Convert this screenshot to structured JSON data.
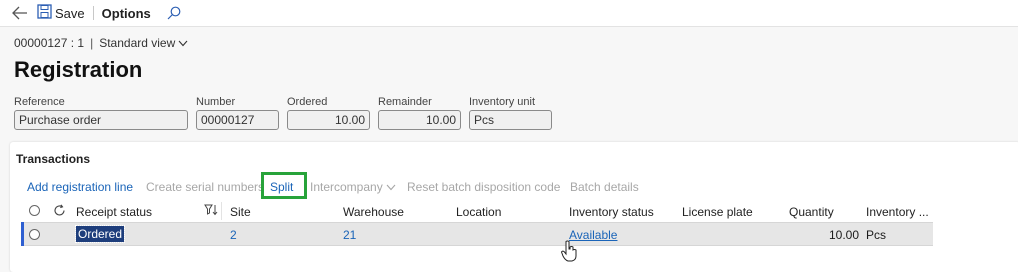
{
  "toolbar": {
    "save_label": "Save",
    "options_label": "Options"
  },
  "breadcrumb": {
    "record": "00000127 : 1",
    "separator": "|",
    "view": "Standard view"
  },
  "page_title": "Registration",
  "header_fields": [
    {
      "label": "Reference",
      "value": "Purchase order"
    },
    {
      "label": "Number",
      "value": "00000127"
    },
    {
      "label": "Ordered",
      "value": "10.00"
    },
    {
      "label": "Remainder",
      "value": "10.00"
    },
    {
      "label": "Inventory unit",
      "value": "Pcs"
    }
  ],
  "transactions": {
    "title": "Transactions",
    "actions": [
      {
        "label": "Add registration line",
        "enabled": true
      },
      {
        "label": "Create serial numbers",
        "enabled": false
      },
      {
        "label": "Split",
        "enabled": true,
        "highlighted": true
      },
      {
        "label": "Intercompany",
        "enabled": false,
        "has_dropdown": true
      },
      {
        "label": "Reset batch disposition code",
        "enabled": false
      },
      {
        "label": "Batch details",
        "enabled": false
      }
    ],
    "columns": [
      "Receipt status",
      "Site",
      "Warehouse",
      "Location",
      "Inventory status",
      "License plate",
      "Quantity",
      "Inventory ..."
    ],
    "rows": [
      {
        "receipt_status": "Ordered",
        "site": "2",
        "warehouse": "21",
        "location": "",
        "inventory_status": "Available",
        "license_plate": "",
        "quantity": "10.00",
        "inventory_unit": "Pcs"
      }
    ]
  },
  "colors": {
    "link": "#1a64b8",
    "highlight_border": "#28a33a",
    "selected_cell": "#1e3e7c",
    "row_marker": "#2e5fd1"
  },
  "icons": [
    "back-arrow-icon",
    "save-icon",
    "search-icon",
    "chevron-down-icon",
    "filter-sort-icon",
    "refresh-icon",
    "radio-icon",
    "hand-cursor-icon"
  ]
}
